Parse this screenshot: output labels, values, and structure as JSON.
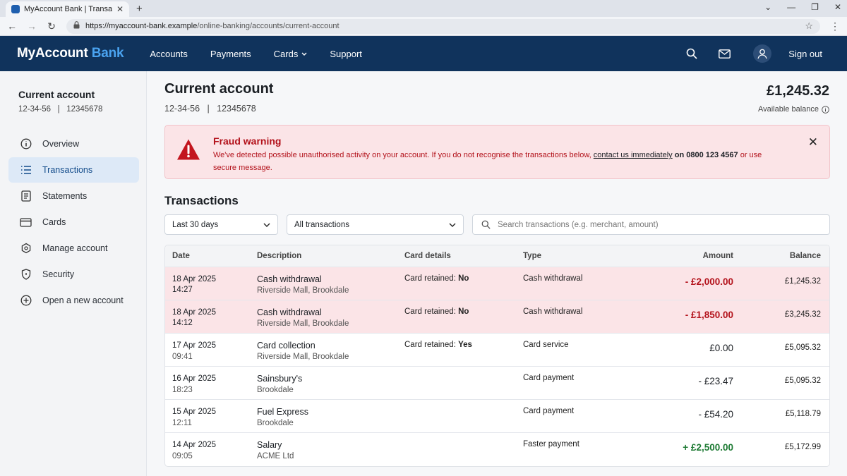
{
  "browser": {
    "tab_title": "MyAccount Bank | Transactions",
    "url_host": "https://myaccount-bank.example",
    "url_path": "/online-banking/accounts/current-account"
  },
  "header": {
    "brand_main": "MyAccount",
    "brand_accent": "Bank",
    "nav": [
      "Accounts",
      "Payments",
      "Cards",
      "Support"
    ],
    "sign_out": "Sign out"
  },
  "sidebar": {
    "account_name": "Current account",
    "account_number": "12-34-56   |   12345678",
    "items": [
      {
        "label": "Overview",
        "icon": "info-icon"
      },
      {
        "label": "Transactions",
        "icon": "list-icon"
      },
      {
        "label": "Statements",
        "icon": "document-icon"
      },
      {
        "label": "Cards",
        "icon": "card-icon"
      },
      {
        "label": "Manage account",
        "icon": "settings-icon"
      },
      {
        "label": "Security",
        "icon": "shield-icon"
      },
      {
        "label": "Open a new account",
        "icon": "plus-circle-icon"
      }
    ]
  },
  "main": {
    "title": "Current account",
    "subtitle": "12-34-56   |   12345678",
    "balance": "£1,245.32",
    "balance_label": "Available balance"
  },
  "alert": {
    "title": "Fraud warning",
    "text_before": "We've detected possible unauthorised activity on your account. If you do not recognise the transactions below, ",
    "link": "contact us immediately",
    "text_on": " on ",
    "phone": "0800 123 4567",
    "text_after": " or use secure message."
  },
  "transactions": {
    "heading": "Transactions",
    "period_filter": "Last 30 days",
    "type_filter": "All transactions",
    "search_placeholder": "Search transactions (e.g. merchant, amount)",
    "columns": {
      "date": "Date",
      "description": "Description",
      "card": "Card details",
      "type": "Type",
      "amount": "Amount",
      "balance": "Balance"
    },
    "rows": [
      {
        "date": "18 Apr 2025",
        "time": "14:27",
        "desc": "Cash withdrawal",
        "location": "Riverside Mall, Brookdale",
        "card_label": "Card retained: ",
        "card_value": "No",
        "type": "Cash withdrawal",
        "amount": "- £2,000.00",
        "balance": "£1,245.32"
      },
      {
        "date": "18 Apr 2025",
        "time": "14:12",
        "desc": "Cash withdrawal",
        "location": "Riverside Mall, Brookdale",
        "card_label": "Card retained: ",
        "card_value": "No",
        "type": "Cash withdrawal",
        "amount": "- £1,850.00",
        "balance": "£3,245.32"
      },
      {
        "date": "17 Apr 2025",
        "time": "09:41",
        "desc": "Card collection",
        "location": "Riverside Mall, Brookdale",
        "card_label": "Card retained: ",
        "card_value": "Yes",
        "type": "Card service",
        "amount": "£0.00",
        "balance": "£5,095.32"
      },
      {
        "date": "16 Apr 2025",
        "time": "18:23",
        "desc": "Sainsbury's",
        "location": "Brookdale",
        "card_label": "",
        "card_value": "",
        "type": "Card payment",
        "amount": "- £23.47",
        "balance": "£5,095.32"
      },
      {
        "date": "15 Apr 2025",
        "time": "12:11",
        "desc": "Fuel Express",
        "location": "Brookdale",
        "card_label": "",
        "card_value": "",
        "type": "Card payment",
        "amount": "- £54.20",
        "balance": "£5,118.79"
      },
      {
        "date": "14 Apr 2025",
        "time": "09:05",
        "desc": "Salary",
        "location": "ACME Ltd",
        "card_label": "",
        "card_value": "",
        "type": "Faster payment",
        "amount": "+ £2,500.00",
        "balance": "£5,172.99"
      }
    ]
  },
  "colors": {
    "header_bg": "#10335c",
    "brand_accent": "#4aa3f0",
    "alert_red": "#b3121b",
    "alert_bg": "#fbe4e7",
    "credit_green": "#1d7a33"
  }
}
